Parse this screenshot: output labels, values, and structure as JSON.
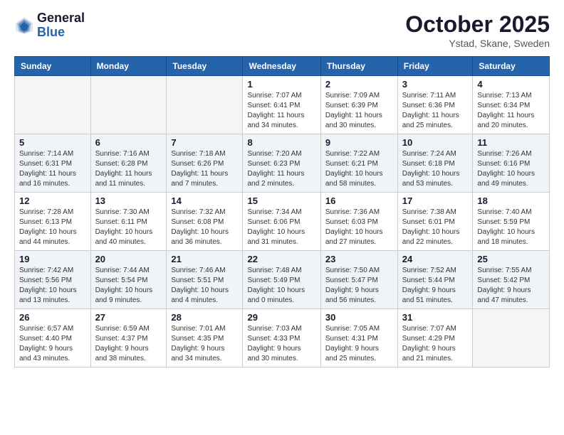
{
  "logo": {
    "general": "General",
    "blue": "Blue"
  },
  "header": {
    "month": "October 2025",
    "location": "Ystad, Skane, Sweden"
  },
  "weekdays": [
    "Sunday",
    "Monday",
    "Tuesday",
    "Wednesday",
    "Thursday",
    "Friday",
    "Saturday"
  ],
  "weeks": [
    [
      {
        "day": "",
        "info": ""
      },
      {
        "day": "",
        "info": ""
      },
      {
        "day": "",
        "info": ""
      },
      {
        "day": "1",
        "info": "Sunrise: 7:07 AM\nSunset: 6:41 PM\nDaylight: 11 hours\nand 34 minutes."
      },
      {
        "day": "2",
        "info": "Sunrise: 7:09 AM\nSunset: 6:39 PM\nDaylight: 11 hours\nand 30 minutes."
      },
      {
        "day": "3",
        "info": "Sunrise: 7:11 AM\nSunset: 6:36 PM\nDaylight: 11 hours\nand 25 minutes."
      },
      {
        "day": "4",
        "info": "Sunrise: 7:13 AM\nSunset: 6:34 PM\nDaylight: 11 hours\nand 20 minutes."
      }
    ],
    [
      {
        "day": "5",
        "info": "Sunrise: 7:14 AM\nSunset: 6:31 PM\nDaylight: 11 hours\nand 16 minutes."
      },
      {
        "day": "6",
        "info": "Sunrise: 7:16 AM\nSunset: 6:28 PM\nDaylight: 11 hours\nand 11 minutes."
      },
      {
        "day": "7",
        "info": "Sunrise: 7:18 AM\nSunset: 6:26 PM\nDaylight: 11 hours\nand 7 minutes."
      },
      {
        "day": "8",
        "info": "Sunrise: 7:20 AM\nSunset: 6:23 PM\nDaylight: 11 hours\nand 2 minutes."
      },
      {
        "day": "9",
        "info": "Sunrise: 7:22 AM\nSunset: 6:21 PM\nDaylight: 10 hours\nand 58 minutes."
      },
      {
        "day": "10",
        "info": "Sunrise: 7:24 AM\nSunset: 6:18 PM\nDaylight: 10 hours\nand 53 minutes."
      },
      {
        "day": "11",
        "info": "Sunrise: 7:26 AM\nSunset: 6:16 PM\nDaylight: 10 hours\nand 49 minutes."
      }
    ],
    [
      {
        "day": "12",
        "info": "Sunrise: 7:28 AM\nSunset: 6:13 PM\nDaylight: 10 hours\nand 44 minutes."
      },
      {
        "day": "13",
        "info": "Sunrise: 7:30 AM\nSunset: 6:11 PM\nDaylight: 10 hours\nand 40 minutes."
      },
      {
        "day": "14",
        "info": "Sunrise: 7:32 AM\nSunset: 6:08 PM\nDaylight: 10 hours\nand 36 minutes."
      },
      {
        "day": "15",
        "info": "Sunrise: 7:34 AM\nSunset: 6:06 PM\nDaylight: 10 hours\nand 31 minutes."
      },
      {
        "day": "16",
        "info": "Sunrise: 7:36 AM\nSunset: 6:03 PM\nDaylight: 10 hours\nand 27 minutes."
      },
      {
        "day": "17",
        "info": "Sunrise: 7:38 AM\nSunset: 6:01 PM\nDaylight: 10 hours\nand 22 minutes."
      },
      {
        "day": "18",
        "info": "Sunrise: 7:40 AM\nSunset: 5:59 PM\nDaylight: 10 hours\nand 18 minutes."
      }
    ],
    [
      {
        "day": "19",
        "info": "Sunrise: 7:42 AM\nSunset: 5:56 PM\nDaylight: 10 hours\nand 13 minutes."
      },
      {
        "day": "20",
        "info": "Sunrise: 7:44 AM\nSunset: 5:54 PM\nDaylight: 10 hours\nand 9 minutes."
      },
      {
        "day": "21",
        "info": "Sunrise: 7:46 AM\nSunset: 5:51 PM\nDaylight: 10 hours\nand 4 minutes."
      },
      {
        "day": "22",
        "info": "Sunrise: 7:48 AM\nSunset: 5:49 PM\nDaylight: 10 hours\nand 0 minutes."
      },
      {
        "day": "23",
        "info": "Sunrise: 7:50 AM\nSunset: 5:47 PM\nDaylight: 9 hours\nand 56 minutes."
      },
      {
        "day": "24",
        "info": "Sunrise: 7:52 AM\nSunset: 5:44 PM\nDaylight: 9 hours\nand 51 minutes."
      },
      {
        "day": "25",
        "info": "Sunrise: 7:55 AM\nSunset: 5:42 PM\nDaylight: 9 hours\nand 47 minutes."
      }
    ],
    [
      {
        "day": "26",
        "info": "Sunrise: 6:57 AM\nSunset: 4:40 PM\nDaylight: 9 hours\nand 43 minutes."
      },
      {
        "day": "27",
        "info": "Sunrise: 6:59 AM\nSunset: 4:37 PM\nDaylight: 9 hours\nand 38 minutes."
      },
      {
        "day": "28",
        "info": "Sunrise: 7:01 AM\nSunset: 4:35 PM\nDaylight: 9 hours\nand 34 minutes."
      },
      {
        "day": "29",
        "info": "Sunrise: 7:03 AM\nSunset: 4:33 PM\nDaylight: 9 hours\nand 30 minutes."
      },
      {
        "day": "30",
        "info": "Sunrise: 7:05 AM\nSunset: 4:31 PM\nDaylight: 9 hours\nand 25 minutes."
      },
      {
        "day": "31",
        "info": "Sunrise: 7:07 AM\nSunset: 4:29 PM\nDaylight: 9 hours\nand 21 minutes."
      },
      {
        "day": "",
        "info": ""
      }
    ]
  ]
}
